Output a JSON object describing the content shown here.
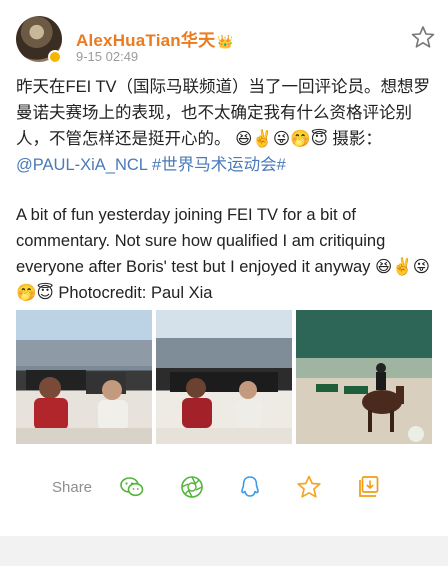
{
  "post": {
    "username": "AlexHuaTian华天",
    "timestamp": "9-15 02:49",
    "text_zh": "昨天在FEI TV（国际马联频道）当了一回评论员。想想罗曼诺夫赛场上的表现，也不太确定我有什么资格评论别人，不管怎样还是挺开心的。",
    "emoji_zh": "😆✌️😜🤭😇",
    "photo_credit_label": " 摄影：",
    "mention": "@PAUL-XiA_NCL",
    "hashtag": "#世界马术运动会#",
    "text_en": "A bit of fun yesterday joining FEI TV for a bit of commentary. Not sure how qualified I am critiquing everyone after Boris' test but I enjoyed it anyway",
    "emoji_en": "😆✌️😜🤭😇",
    "photo_credit_en": " Photocredit: Paul Xia"
  },
  "share": {
    "label": "Share"
  },
  "colors": {
    "username": "#ea7b1f",
    "link": "#4a7ab8",
    "icon_green": "#52b43a",
    "icon_blue": "#3b9be6",
    "icon_yellow": "#f5a623",
    "icon_orange": "#f39c12"
  },
  "icons": [
    "avatar",
    "verified-badge",
    "favorite-star-icon",
    "wechat-icon",
    "moments-icon",
    "qq-icon",
    "favorite-icon",
    "save-image-icon"
  ]
}
